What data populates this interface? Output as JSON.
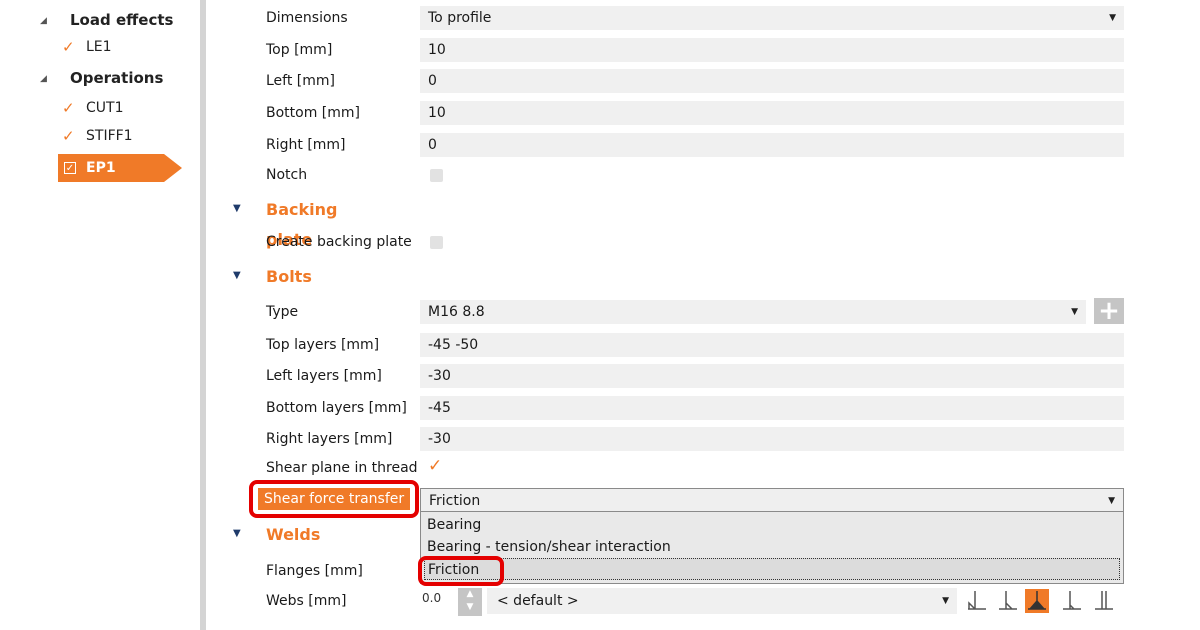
{
  "tree": {
    "sections": [
      {
        "label": "Load effects",
        "items": [
          {
            "label": "LE1"
          }
        ]
      },
      {
        "label": "Operations",
        "items": [
          {
            "label": "CUT1"
          },
          {
            "label": "STIFF1"
          }
        ]
      }
    ],
    "selected_item": {
      "label": "EP1"
    }
  },
  "properties": {
    "dimensions": {
      "label": "Dimensions",
      "value": "To profile"
    },
    "top": {
      "label": "Top [mm]",
      "value": "10"
    },
    "left": {
      "label": "Left [mm]",
      "value": "0"
    },
    "bottom": {
      "label": "Bottom [mm]",
      "value": "10"
    },
    "right": {
      "label": "Right [mm]",
      "value": "0"
    },
    "notch": {
      "label": "Notch",
      "checked": false
    }
  },
  "backing_plate": {
    "title": "Backing plate",
    "create": {
      "label": "Create backing plate",
      "checked": false
    }
  },
  "bolts": {
    "title": "Bolts",
    "type": {
      "label": "Type",
      "value": "M16 8.8"
    },
    "top_layers": {
      "label": "Top layers [mm]",
      "value": "-45 -50"
    },
    "left_layers": {
      "label": "Left layers [mm]",
      "value": "-30"
    },
    "bottom_layers": {
      "label": "Bottom layers [mm]",
      "value": "-45"
    },
    "right_layers": {
      "label": "Right layers [mm]",
      "value": "-30"
    },
    "shear_plane": {
      "label": "Shear plane in thread",
      "checked": true
    },
    "shear_force_transfer": {
      "label": "Shear force transfer",
      "value": "Friction",
      "options": [
        "Bearing",
        "Bearing - tension/shear interaction",
        "Friction"
      ]
    }
  },
  "welds": {
    "title": "Welds",
    "flanges": {
      "label": "Flanges [mm]"
    },
    "webs": {
      "label": "Webs [mm]",
      "thickness": "0.0",
      "type": "< default >"
    }
  },
  "colors": {
    "accent": "#f07a28",
    "highlight": "#e40000"
  }
}
